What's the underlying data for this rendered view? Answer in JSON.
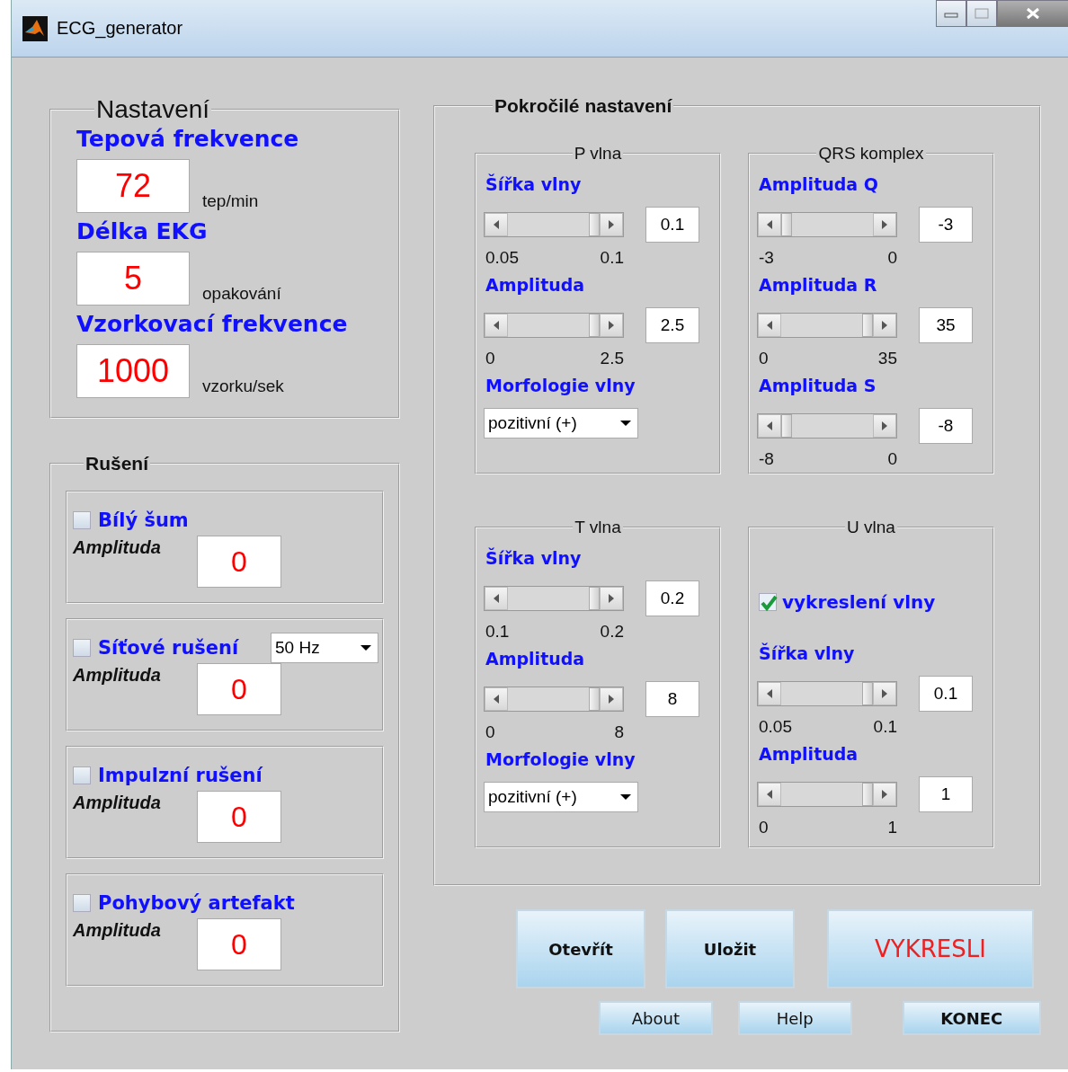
{
  "window": {
    "title": "ECG_generator"
  },
  "settings": {
    "title": "Nastavení",
    "fields": [
      {
        "label": "Tepová frekvence",
        "value": "72",
        "unit": "tep/min"
      },
      {
        "label": "Délka EKG",
        "value": "5",
        "unit": "opakování"
      },
      {
        "label": "Vzorkovací frekvence",
        "value": "1000",
        "unit": "vzorku/sek"
      }
    ]
  },
  "noise": {
    "title": "Rušení",
    "items": [
      {
        "label": "Bílý šum",
        "checked": false,
        "amplitude_label": "Amplituda",
        "value": "0"
      },
      {
        "label": "Síťové rušení",
        "checked": false,
        "dropdown": "50 Hz",
        "amplitude_label": "Amplituda",
        "value": "0"
      },
      {
        "label": "Impulzní rušení",
        "checked": false,
        "amplitude_label": "Amplituda",
        "value": "0"
      },
      {
        "label": "Pohybový artefakt",
        "checked": false,
        "amplitude_label": "Amplituda",
        "value": "0"
      }
    ]
  },
  "advanced": {
    "title": "Pokročilé nastavení",
    "groups": [
      {
        "title": "P vlna",
        "rows": [
          {
            "kind": "slider",
            "label": "Šířka vlny",
            "min": "0.05",
            "max": "0.1",
            "value": "0.1"
          },
          {
            "kind": "slider",
            "label": "Amplituda",
            "min": "0",
            "max": "2.5",
            "value": "2.5"
          },
          {
            "kind": "dropdown",
            "label": "Morfologie vlny",
            "value": "pozitivní (+)"
          }
        ]
      },
      {
        "title": "QRS komplex",
        "rows": [
          {
            "kind": "slider",
            "label": "Amplituda Q",
            "min": "-3",
            "max": "0",
            "value": "-3"
          },
          {
            "kind": "slider",
            "label": "Amplituda R",
            "min": "0",
            "max": "35",
            "value": "35"
          },
          {
            "kind": "slider",
            "label": "Amplituda S",
            "min": "-8",
            "max": "0",
            "value": "-8"
          }
        ]
      },
      {
        "title": "T vlna",
        "rows": [
          {
            "kind": "slider",
            "label": "Šířka vlny",
            "min": "0.1",
            "max": "0.2",
            "value": "0.2"
          },
          {
            "kind": "slider",
            "label": "Amplituda",
            "min": "0",
            "max": "8",
            "value": "8"
          },
          {
            "kind": "dropdown",
            "label": "Morfologie vlny",
            "value": "pozitivní (+)"
          }
        ]
      },
      {
        "title": "U vlna",
        "rows": [
          {
            "kind": "checkbox",
            "label": "vykreslení vlny",
            "checked": true
          },
          {
            "kind": "slider",
            "label": "Šířka vlny",
            "min": "0.05",
            "max": "0.1",
            "value": "0.1"
          },
          {
            "kind": "slider",
            "label": "Amplituda",
            "min": "0",
            "max": "1",
            "value": "1"
          }
        ]
      }
    ]
  },
  "buttons": [
    {
      "label": "Otevřít",
      "kind": "large"
    },
    {
      "label": "Uložit",
      "kind": "large"
    },
    {
      "label": "VYKRESLI",
      "kind": "primary"
    },
    {
      "label": "About",
      "kind": "small"
    },
    {
      "label": "Help",
      "kind": "small"
    },
    {
      "label": "KONEC",
      "kind": "small-bold"
    }
  ]
}
